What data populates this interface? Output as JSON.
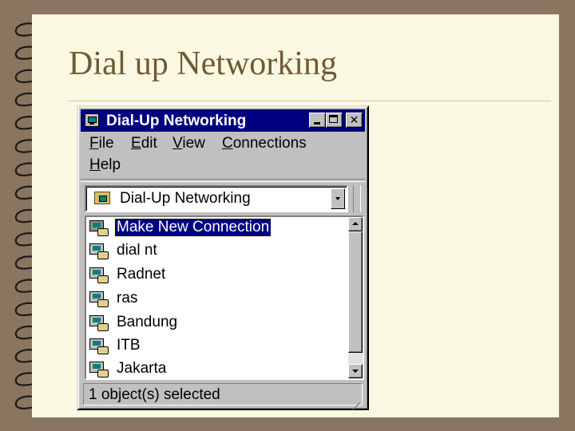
{
  "slide": {
    "title": "Dial up Networking"
  },
  "window": {
    "title": "Dial-Up Networking",
    "controls": {
      "minimize": "minimize-icon",
      "maximize": "maximize-icon",
      "close": "close-icon"
    },
    "title_bar_color": "#000080"
  },
  "menu": {
    "items": [
      {
        "label": "File"
      },
      {
        "label": "Edit"
      },
      {
        "label": "View"
      },
      {
        "label": "Connections"
      },
      {
        "label": "Help"
      }
    ]
  },
  "address": {
    "value": "Dial-Up Networking"
  },
  "list": {
    "items": [
      {
        "label": "Make New Connection",
        "selected": true
      },
      {
        "label": "dial nt"
      },
      {
        "label": "Radnet"
      },
      {
        "label": "ras"
      },
      {
        "label": "Bandung"
      },
      {
        "label": "ITB"
      },
      {
        "label": "Jakarta"
      }
    ]
  },
  "status": {
    "text": "1 object(s) selected"
  },
  "colors": {
    "background": "#8a7560",
    "slide": "#fbf8e2",
    "title_text": "#6f5a33",
    "selection": "#000080"
  }
}
